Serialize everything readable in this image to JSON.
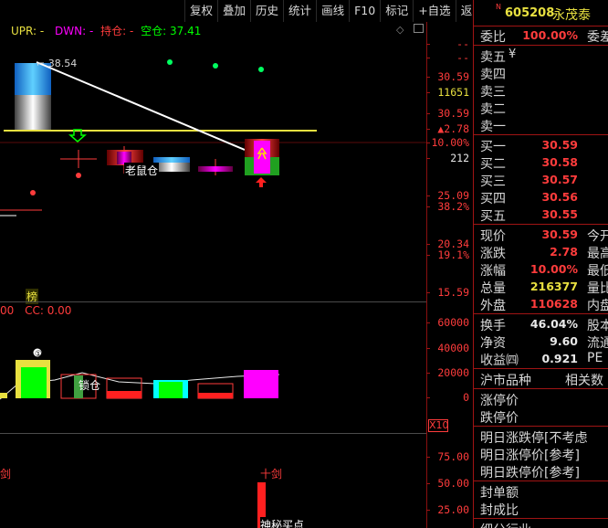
{
  "toolbar": {
    "items": [
      "复权",
      "叠加",
      "历史",
      "统计",
      "画线",
      "F10",
      "标记",
      "+自选",
      "返回"
    ]
  },
  "main_chart": {
    "legend": {
      "upr": "UPR: -",
      "dwn": "DWN: -",
      "hold": "持仓: -",
      "empty": "空仓: 37.41"
    },
    "high_marker": "38.54",
    "labels": {
      "box1": "老鼠仓"
    },
    "y_axis": [
      "--",
      "--",
      "30.59",
      "11651",
      "30.59",
      "▲2.78",
      "10.00%",
      "212",
      "25.09",
      "38.2%",
      "20.34",
      "19.1%",
      "15.59"
    ],
    "bottom_tag": "榜"
  },
  "volume_chart": {
    "legend": {
      "a": "00",
      "cc": "CC: 0.00"
    },
    "y_axis": [
      "60000",
      "40000",
      "20000",
      "0"
    ],
    "labels": {
      "lock": "锁仓"
    },
    "multiplier": "X10"
  },
  "lower_chart": {
    "y_axis": [
      "75.00",
      "50.00",
      "25.00"
    ],
    "labels": {
      "left_sword": "剑",
      "right_sword": "十剑",
      "mystery": "神秘买点"
    }
  },
  "stock": {
    "superscript": "N",
    "code": "605208",
    "name": "永茂泰"
  },
  "panel": {
    "weibi": {
      "label": "委比",
      "value": "100.00%",
      "ext": "委差"
    },
    "sell": [
      {
        "label": "卖五",
        "value": "¥"
      },
      {
        "label": "卖四",
        "value": ""
      },
      {
        "label": "卖三",
        "value": ""
      },
      {
        "label": "卖二",
        "value": ""
      },
      {
        "label": "卖一",
        "value": ""
      }
    ],
    "buy": [
      {
        "label": "买一",
        "value": "30.59"
      },
      {
        "label": "买二",
        "value": "30.58"
      },
      {
        "label": "买三",
        "value": "30.57"
      },
      {
        "label": "买四",
        "value": "30.56"
      },
      {
        "label": "买五",
        "value": "30.55"
      }
    ],
    "quote": [
      {
        "label": "现价",
        "value": "30.59",
        "ext": "今开",
        "color": "red"
      },
      {
        "label": "涨跌",
        "value": "2.78",
        "ext": "最高",
        "color": "red"
      },
      {
        "label": "涨幅",
        "value": "10.00%",
        "ext": "最低",
        "color": "red"
      },
      {
        "label": "总量",
        "value": "216377",
        "ext": "量比",
        "color": "yellow"
      },
      {
        "label": "外盘",
        "value": "110628",
        "ext": "内盘",
        "color": "red"
      }
    ],
    "stats": [
      {
        "label": "换手",
        "value": "46.04%",
        "ext": "股本",
        "color": "white"
      },
      {
        "label": "净资",
        "value": "9.60",
        "ext": "流通",
        "color": "white"
      },
      {
        "label": "收益㈣",
        "value": "0.921",
        "ext": "PE",
        "color": "white"
      }
    ],
    "section": {
      "label": "沪市品种",
      "ext": "相关数"
    },
    "limits": [
      "涨停价",
      "跌停价"
    ],
    "next_day": [
      "明日涨跌停[不考虑",
      "明日涨停价[参考]",
      "明日跌停价[参考]"
    ],
    "seal": [
      "封单额",
      "封成比"
    ],
    "industry": "细分行业"
  },
  "colors": {
    "accent_red": "#ff3c3c",
    "yellow": "#e8e040",
    "magenta": "#ff00ff",
    "cyan": "#00c8ff",
    "green": "#00ff00",
    "frame_red": "#a01414"
  }
}
